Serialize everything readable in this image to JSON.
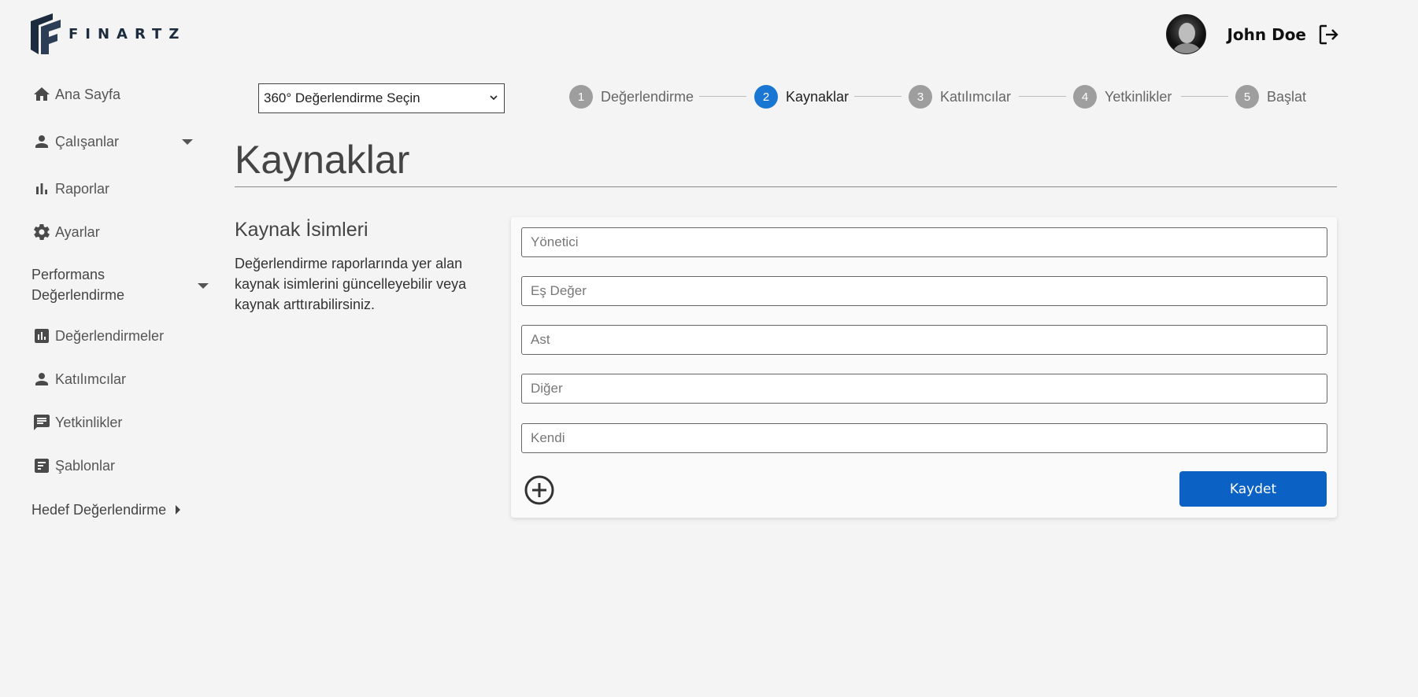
{
  "brand": {
    "name": "FINARTZ",
    "color": "#1c2b3e"
  },
  "user": {
    "name": "John Doe",
    "avatar_icon": "user-avatar",
    "logout_icon": "logout-icon"
  },
  "sidebar": {
    "items": [
      {
        "label": "Ana Sayfa",
        "icon": "home-icon"
      },
      {
        "label": "Çalışanlar",
        "icon": "person-icon"
      },
      {
        "label": "Raporlar",
        "icon": "bar-chart-icon"
      },
      {
        "label": "Ayarlar",
        "icon": "gear-icon"
      }
    ],
    "performance_section": "Performans Değerlendirme",
    "performance_items": [
      {
        "label": "Değerlendirmeler",
        "icon": "chart-box-icon"
      },
      {
        "label": "Katılımcılar",
        "icon": "person-icon"
      },
      {
        "label": "Yetkinlikler",
        "icon": "message-icon"
      },
      {
        "label": "Şablonlar",
        "icon": "template-icon"
      }
    ],
    "goal_section": "Hedef Değerlendirme"
  },
  "evaluation_select": {
    "selected": "360° Değerlendirme Seçin"
  },
  "stepper": {
    "active_index": 1,
    "active_color": "#1976d2",
    "steps": [
      {
        "num": "1",
        "label": "Değerlendirme"
      },
      {
        "num": "2",
        "label": "Kaynaklar"
      },
      {
        "num": "3",
        "label": "Katılımcılar"
      },
      {
        "num": "4",
        "label": "Yetkinlikler"
      },
      {
        "num": "5",
        "label": "Başlat"
      }
    ]
  },
  "page": {
    "title": "Kaynaklar",
    "section_title": "Kaynak İsimleri",
    "section_description": "Değerlendirme raporlarında yer alan kaynak isimlerini güncelleyebilir veya kaynak arttırabilirsiniz."
  },
  "sources": {
    "fields": [
      {
        "placeholder": "Yönetici"
      },
      {
        "placeholder": "Eş Değer"
      },
      {
        "placeholder": "Ast"
      },
      {
        "placeholder": "Diğer"
      },
      {
        "placeholder": "Kendi"
      }
    ],
    "add_icon": "plus-circle-icon",
    "save_label": "Kaydet",
    "save_color": "#0b62c4"
  }
}
